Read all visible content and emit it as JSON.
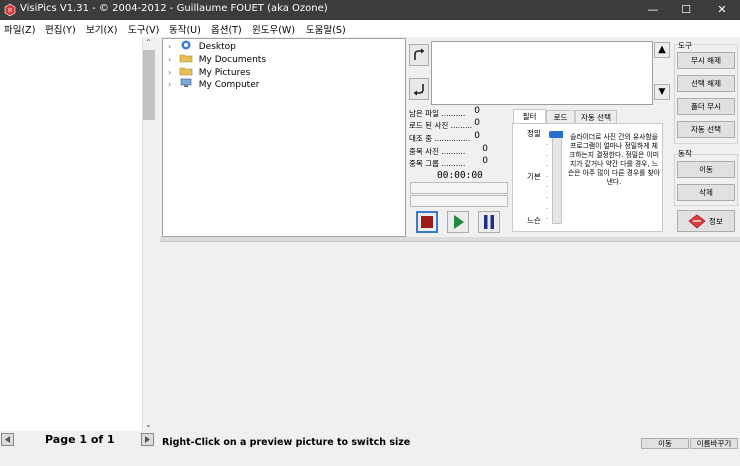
{
  "window": {
    "title": "VisiPics V1.31 - © 2004-2012 - Guillaume FOUET (aka Ozone)",
    "controls": {
      "minimize": "—",
      "maximize": "☐",
      "close": "✕"
    }
  },
  "menu": [
    "파일(Z)",
    "편집(Y)",
    "보기(X)",
    "도구(V)",
    "동작(U)",
    "옵션(T)",
    "윈도우(W)",
    "도움말(S)"
  ],
  "tree": [
    {
      "label": "Desktop",
      "icon": "desktop-icon"
    },
    {
      "label": "My Documents",
      "icon": "folder-icon"
    },
    {
      "label": "My Pictures",
      "icon": "folder-icon"
    },
    {
      "label": "My Computer",
      "icon": "computer-icon"
    }
  ],
  "stats": [
    {
      "label": "남은 파일 ..........",
      "value": "0"
    },
    {
      "label": "로드 된 사진 .........",
      "value": "0"
    },
    {
      "label": "대조 중 ...............",
      "value": "0"
    },
    {
      "label": "중복 사진 ..........",
      "value": "0"
    },
    {
      "label": "중복 그룹 ..........",
      "value": "0"
    }
  ],
  "timer": "00:00:00",
  "tabs": [
    "필터",
    "로드",
    "자동 선택"
  ],
  "slider": {
    "labels": [
      "정밀",
      "기본",
      "느슨"
    ],
    "level": 0.0
  },
  "help_text": "슬라이더로 사진 간의 유사함을 프로그램이 얼마나 정밀하게 체크하는지 결정한다. 정밀은 이미지가 같거나 약간 다를 경우, 느슨은 아주 많이 다른 경우를 찾아낸다.",
  "tools": {
    "group_label": "도구",
    "buttons": [
      "무시 해제",
      "선택 해제",
      "폴더 무시",
      "자동 선택"
    ]
  },
  "actions": {
    "group_label": "동작",
    "buttons": [
      "이동",
      "삭제"
    ],
    "info_label": "정보"
  },
  "left_footer": {
    "page": "Page 1 of 1"
  },
  "status": {
    "text": "Right-Click on a preview picture to switch size",
    "move_button": "이동",
    "rename_button": "이름바꾸기"
  },
  "colors": {
    "titlebar": "#3c3c3c",
    "stop": "#9c1b1b",
    "play": "#1f8a3a",
    "pause": "#1f2f8a"
  }
}
